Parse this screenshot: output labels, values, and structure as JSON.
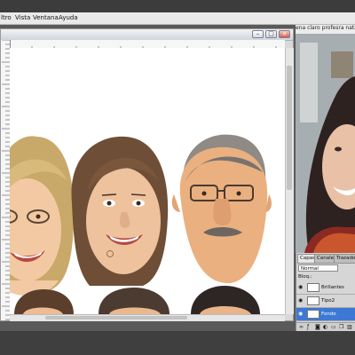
{
  "menubar": {
    "items": [
      "ltro",
      "Vista",
      "Ventana",
      "Ayuda"
    ]
  },
  "webcam": {
    "title": "ena claro profesra natal"
  },
  "layers_panel": {
    "tabs": [
      "Capas",
      "Canales",
      "Trazados"
    ],
    "blend_mode": "Normal",
    "lock_label": "Bloq.:",
    "layers": [
      {
        "name": "Brillantes",
        "selected": false
      },
      {
        "name": "Tipo2",
        "selected": false
      },
      {
        "name": "Fondo",
        "selected": true
      }
    ],
    "footer_icons": [
      "link-icon",
      "fx-icon",
      "mask-icon",
      "adjustment-icon",
      "folder-icon",
      "new-layer-icon",
      "trash-icon"
    ]
  },
  "colors": {
    "selected_layer": "#3d78d6",
    "title_bar": "#cfd6df"
  }
}
